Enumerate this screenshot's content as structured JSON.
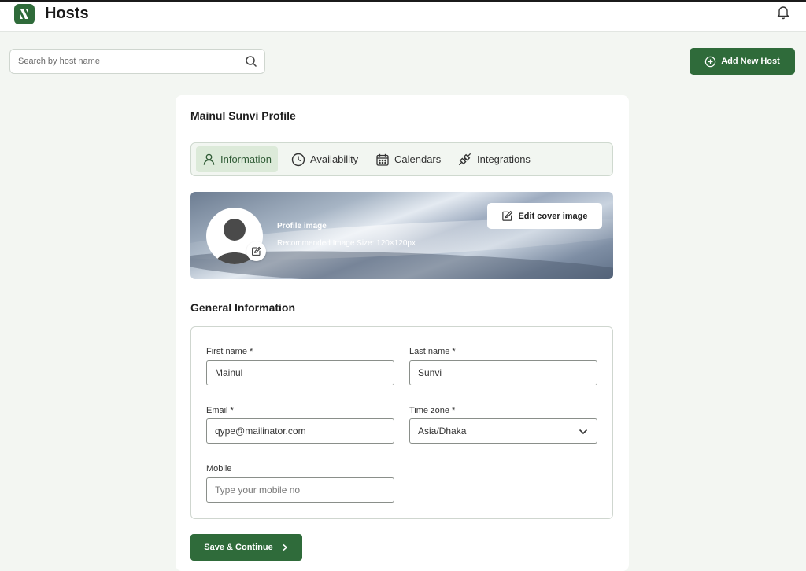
{
  "header": {
    "title": "Hosts",
    "logo_icon": "logo-icon",
    "notification_icon": "bell-icon"
  },
  "search": {
    "placeholder": "Search by host name",
    "value": ""
  },
  "actions": {
    "add_host_label": "Add New Host"
  },
  "profile": {
    "title": "Mainul Sunvi Profile",
    "tabs": [
      {
        "label": "Information",
        "icon": "user-icon",
        "active": true
      },
      {
        "label": "Availability",
        "icon": "clock-icon",
        "active": false
      },
      {
        "label": "Calendars",
        "icon": "calendar-icon",
        "active": false
      },
      {
        "label": "Integrations",
        "icon": "plug-icon",
        "active": false
      }
    ],
    "cover": {
      "image_label": "Profile image",
      "image_hint": "Recommended Image Size: 120×120px",
      "edit_cover_label": "Edit cover image"
    }
  },
  "general": {
    "title": "General Information",
    "first_name": {
      "label": "First name *",
      "value": "Mainul"
    },
    "last_name": {
      "label": "Last name *",
      "value": "Sunvi"
    },
    "email": {
      "label": "Email *",
      "value": "qype@mailinator.com"
    },
    "timezone": {
      "label": "Time zone *",
      "value": "Asia/Dhaka"
    },
    "mobile": {
      "label": "Mobile",
      "value": "",
      "placeholder": "Type your mobile no"
    }
  },
  "footer": {
    "save_label": "Save & Continue"
  },
  "colors": {
    "brand": "#2f6b3a",
    "active_tab_bg": "#dcead9",
    "page_bg": "#f3f6f2"
  }
}
